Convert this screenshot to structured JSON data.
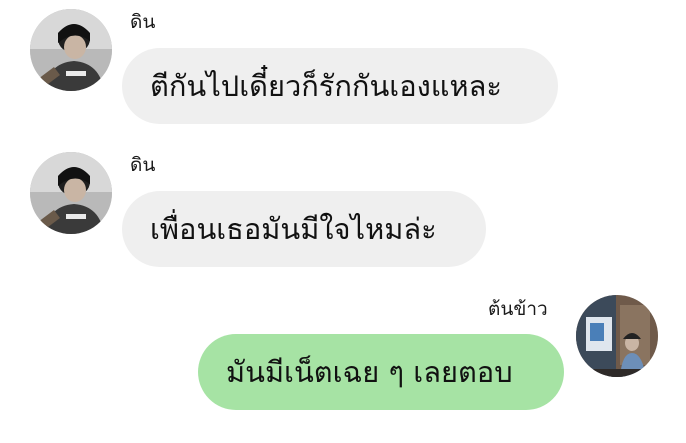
{
  "messages": [
    {
      "sender": "ดิน",
      "text": "ตีกันไปเดี๋ยวก็รักกันเองแหละ",
      "direction": "incoming"
    },
    {
      "sender": "ดิน",
      "text": "เพื่อนเธอมันมีใจไหมล่ะ",
      "direction": "incoming"
    },
    {
      "sender": "ต้นข้าว",
      "text": "มันมีเน็ตเฉย ๆ เลยตอบ",
      "direction": "outgoing"
    }
  ],
  "colors": {
    "incoming_bubble": "#efefef",
    "outgoing_bubble": "#a6e3a4",
    "background": "#ffffff"
  },
  "icons": {
    "avatar_1": "profile-photo-din",
    "avatar_2": "profile-photo-din",
    "avatar_3": "profile-photo-tonkhao"
  }
}
